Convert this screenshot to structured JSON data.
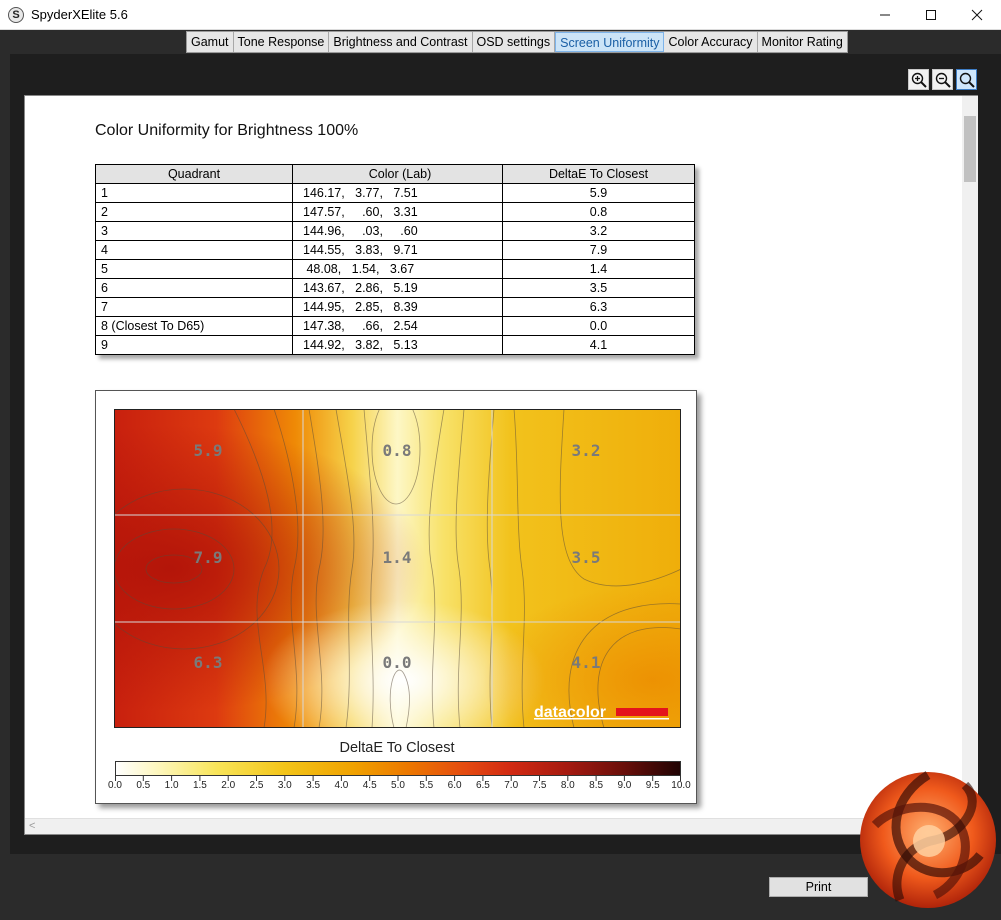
{
  "window": {
    "title": "SpyderXElite 5.6",
    "icon_letter": "S"
  },
  "tabs": [
    {
      "label": "Gamut",
      "active": false
    },
    {
      "label": "Tone Response",
      "active": false
    },
    {
      "label": "Brightness and Contrast",
      "active": false
    },
    {
      "label": "OSD settings",
      "active": false
    },
    {
      "label": "Screen Uniformity",
      "active": true
    },
    {
      "label": "Color Accuracy",
      "active": false
    },
    {
      "label": "Monitor Rating",
      "active": false
    }
  ],
  "report": {
    "title": "Color Uniformity for Brightness 100%",
    "table": {
      "headers": [
        "Quadrant",
        "Color (Lab)",
        "DeltaE To Closest"
      ],
      "rows": [
        {
          "quadrant": "1",
          "lab": "146.17,   3.77,   7.51",
          "delta": "5.9"
        },
        {
          "quadrant": "2",
          "lab": "147.57,     .60,   3.31",
          "delta": "0.8"
        },
        {
          "quadrant": "3",
          "lab": "144.96,     .03,     .60",
          "delta": "3.2"
        },
        {
          "quadrant": "4",
          "lab": "144.55,   3.83,   9.71",
          "delta": "7.9"
        },
        {
          "quadrant": "5",
          "lab": " 48.08,   1.54,   3.67",
          "delta": "1.4"
        },
        {
          "quadrant": "6",
          "lab": "143.67,   2.86,   5.19",
          "delta": "3.5"
        },
        {
          "quadrant": "7",
          "lab": "144.95,   2.85,   8.39",
          "delta": "6.3"
        },
        {
          "quadrant": "8 (Closest To D65)",
          "lab": "147.38,     .66,   2.54",
          "delta": "0.0"
        },
        {
          "quadrant": "9",
          "lab": "144.92,   3.82,   5.13",
          "delta": "4.1"
        }
      ]
    },
    "heatmap": {
      "grid_values": [
        [
          "5.9",
          "0.8",
          "3.2"
        ],
        [
          "7.9",
          "1.4",
          "3.5"
        ],
        [
          "6.3",
          "0.0",
          "4.1"
        ]
      ],
      "watermark": "datacolor",
      "watermark_color": "#e4131b",
      "legend_title": "DeltaE To Closest",
      "legend_scale": [
        "0.0",
        "0.5",
        "1.0",
        "1.5",
        "2.0",
        "2.5",
        "3.0",
        "3.5",
        "4.0",
        "4.5",
        "5.0",
        "5.5",
        "6.0",
        "6.5",
        "7.0",
        "7.5",
        "8.0",
        "8.5",
        "9.0",
        "9.5",
        "10.0"
      ]
    }
  },
  "zoom_tools": [
    {
      "name": "zoom-in-icon",
      "active": false
    },
    {
      "name": "zoom-out-icon",
      "active": false
    },
    {
      "name": "zoom-fit-icon",
      "active": true
    }
  ],
  "actions": {
    "print_label": "Print"
  },
  "colors": {
    "active_tab_bg": "#cce4f7",
    "active_tab_text": "#1a5fa5",
    "heat_max": "#c31c0c",
    "heat_min": "#ffffff"
  }
}
